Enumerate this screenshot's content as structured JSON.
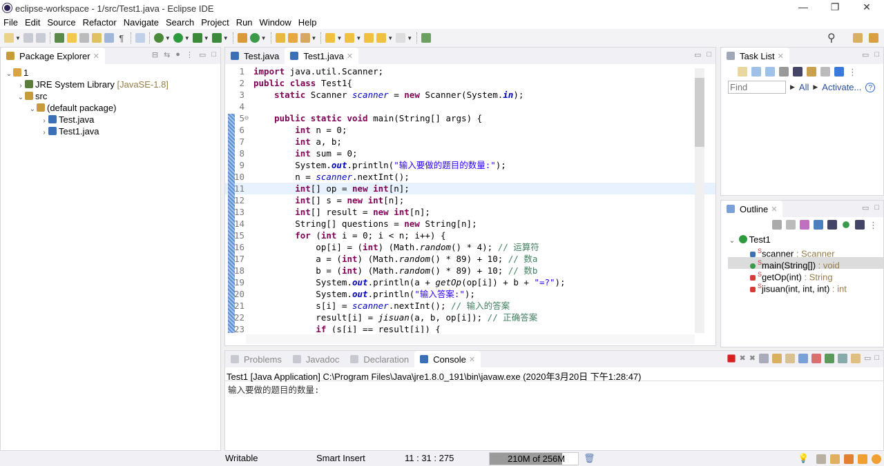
{
  "window": {
    "title": "eclipse-workspace - 1/src/Test1.java - Eclipse IDE",
    "min": "—",
    "restore": "❐",
    "close": "✕"
  },
  "menu": [
    "File",
    "Edit",
    "Source",
    "Refactor",
    "Navigate",
    "Search",
    "Project",
    "Run",
    "Window",
    "Help"
  ],
  "package_explorer": {
    "title": "Package Explorer",
    "tree": [
      {
        "label": "1",
        "decor": "",
        "depth": 0,
        "twisty": "⌄",
        "icon": "java-project-icon",
        "color": "#d9a441"
      },
      {
        "label": "JRE System Library",
        "decor": " [JavaSE-1.8]",
        "depth": 1,
        "twisty": "›",
        "icon": "library-icon",
        "color": "#5a7d3a"
      },
      {
        "label": "src",
        "decor": "",
        "depth": 1,
        "twisty": "⌄",
        "icon": "source-folder-icon",
        "color": "#c79a3c"
      },
      {
        "label": "(default package)",
        "decor": "",
        "depth": 2,
        "twisty": "⌄",
        "icon": "package-icon",
        "color": "#c79a3c"
      },
      {
        "label": "Test.java",
        "decor": "",
        "depth": 3,
        "twisty": "›",
        "icon": "java-file-icon",
        "color": "#3b6fb6"
      },
      {
        "label": "Test1.java",
        "decor": "",
        "depth": 3,
        "twisty": "›",
        "icon": "java-file-icon",
        "color": "#3b6fb6"
      }
    ]
  },
  "editor": {
    "tabs": [
      {
        "label": "Test.java",
        "active": false
      },
      {
        "label": "Test1.java",
        "active": true
      }
    ],
    "current_line": 11,
    "lines": [
      [
        [
          "k",
          "import"
        ],
        [
          "p",
          " java.util.Scanner;"
        ]
      ],
      [
        [
          "k",
          "public"
        ],
        [
          "p",
          " "
        ],
        [
          "k",
          "class"
        ],
        [
          "p",
          " Test1{"
        ]
      ],
      [
        [
          "p",
          "    "
        ],
        [
          "k",
          "static"
        ],
        [
          "p",
          " Scanner "
        ],
        [
          "f",
          "scanner"
        ],
        [
          "p",
          " = "
        ],
        [
          "k",
          "new"
        ],
        [
          "p",
          " Scanner(System."
        ],
        [
          "fb",
          "in"
        ],
        [
          "p",
          ");"
        ]
      ],
      [],
      [
        [
          "p",
          "    "
        ],
        [
          "k",
          "public"
        ],
        [
          "p",
          " "
        ],
        [
          "k",
          "static"
        ],
        [
          "p",
          " "
        ],
        [
          "k",
          "void"
        ],
        [
          "p",
          " main(String[] args) {"
        ]
      ],
      [
        [
          "p",
          "        "
        ],
        [
          "k",
          "int"
        ],
        [
          "p",
          " n = 0;"
        ]
      ],
      [
        [
          "p",
          "        "
        ],
        [
          "k",
          "int"
        ],
        [
          "p",
          " a, b;"
        ]
      ],
      [
        [
          "p",
          "        "
        ],
        [
          "k",
          "int"
        ],
        [
          "p",
          " sum = 0;"
        ]
      ],
      [
        [
          "p",
          "        System."
        ],
        [
          "fb",
          "out"
        ],
        [
          "p",
          ".println("
        ],
        [
          "s",
          "\"输入要做的题目的数量:\""
        ],
        [
          "p",
          ");"
        ]
      ],
      [
        [
          "p",
          "        n = "
        ],
        [
          "f",
          "scanner"
        ],
        [
          "p",
          ".nextInt();"
        ]
      ],
      [
        [
          "p",
          "        "
        ],
        [
          "k",
          "int"
        ],
        [
          "p",
          "[] op = "
        ],
        [
          "k",
          "new"
        ],
        [
          "p",
          " "
        ],
        [
          "k",
          "int"
        ],
        [
          "p",
          "[n];"
        ]
      ],
      [
        [
          "p",
          "        "
        ],
        [
          "k",
          "int"
        ],
        [
          "p",
          "[] s = "
        ],
        [
          "k",
          "new"
        ],
        [
          "p",
          " "
        ],
        [
          "k",
          "int"
        ],
        [
          "p",
          "[n];"
        ]
      ],
      [
        [
          "p",
          "        "
        ],
        [
          "k",
          "int"
        ],
        [
          "p",
          "[] result = "
        ],
        [
          "k",
          "new"
        ],
        [
          "p",
          " "
        ],
        [
          "k",
          "int"
        ],
        [
          "p",
          "[n];"
        ]
      ],
      [
        [
          "p",
          "        String[] questions = "
        ],
        [
          "k",
          "new"
        ],
        [
          "p",
          " String[n];"
        ]
      ],
      [
        [
          "p",
          "        "
        ],
        [
          "k",
          "for"
        ],
        [
          "p",
          " ("
        ],
        [
          "k",
          "int"
        ],
        [
          "p",
          " i = 0; i < n; i++) {"
        ]
      ],
      [
        [
          "p",
          "            op[i] = ("
        ],
        [
          "k",
          "int"
        ],
        [
          "p",
          ") (Math."
        ],
        [
          "m",
          "random"
        ],
        [
          "p",
          "() * 4); "
        ],
        [
          "c",
          "// 运算符"
        ]
      ],
      [
        [
          "p",
          "            a = ("
        ],
        [
          "k",
          "int"
        ],
        [
          "p",
          ") (Math."
        ],
        [
          "m",
          "random"
        ],
        [
          "p",
          "() * 89) + 10; "
        ],
        [
          "c",
          "// 数a"
        ]
      ],
      [
        [
          "p",
          "            b = ("
        ],
        [
          "k",
          "int"
        ],
        [
          "p",
          ") (Math."
        ],
        [
          "m",
          "random"
        ],
        [
          "p",
          "() * 89) + 10; "
        ],
        [
          "c",
          "// 数b"
        ]
      ],
      [
        [
          "p",
          "            System."
        ],
        [
          "fb",
          "out"
        ],
        [
          "p",
          ".println(a + "
        ],
        [
          "m",
          "getOp"
        ],
        [
          "p",
          "(op[i]) + b + "
        ],
        [
          "s",
          "\"=?\""
        ],
        [
          "p",
          ");"
        ]
      ],
      [
        [
          "p",
          "            System."
        ],
        [
          "fb",
          "out"
        ],
        [
          "p",
          ".println("
        ],
        [
          "s",
          "\"输入答案:\""
        ],
        [
          "p",
          ");"
        ]
      ],
      [
        [
          "p",
          "            s[i] = "
        ],
        [
          "f",
          "scanner"
        ],
        [
          "p",
          ".nextInt(); "
        ],
        [
          "c",
          "// 输入的答案"
        ]
      ],
      [
        [
          "p",
          "            result[i] = "
        ],
        [
          "m",
          "jisuan"
        ],
        [
          "p",
          "(a, b, op[i]); "
        ],
        [
          "c",
          "// 正确答案"
        ]
      ],
      [
        [
          "p",
          "            "
        ],
        [
          "k",
          "if"
        ],
        [
          "p",
          " (s[i] == result[i]) {"
        ]
      ]
    ]
  },
  "task_list": {
    "title": "Task List",
    "find_placeholder": "Find",
    "all": "All",
    "activate": "Activate...",
    "help": "?"
  },
  "outline": {
    "title": "Outline",
    "root": "Test1",
    "items": [
      {
        "name": "scanner",
        "type": " : Scanner",
        "icon": "field-default-icon",
        "color": "#3b6fb6",
        "selected": false
      },
      {
        "name": "main(String[])",
        "type": " : void",
        "icon": "method-public-icon",
        "color": "#3a9a4a",
        "selected": true
      },
      {
        "name": "getOp(int)",
        "type": " : String",
        "icon": "method-private-icon",
        "color": "#d83a3a",
        "selected": false
      },
      {
        "name": "jisuan(int, int, int)",
        "type": " : int",
        "icon": "method-private-icon",
        "color": "#d83a3a",
        "selected": false
      }
    ],
    "static_marker": "S"
  },
  "bottom": {
    "tabs": [
      {
        "label": "Problems",
        "active": false
      },
      {
        "label": "Javadoc",
        "active": false
      },
      {
        "label": "Declaration",
        "active": false
      },
      {
        "label": "Console",
        "active": true
      }
    ],
    "console_header": "Test1 [Java Application] C:\\Program Files\\Java\\jre1.8.0_191\\bin\\javaw.exe (2020年3月20日 下午1:28:47)",
    "console_output": "输入要做的题目的数量:"
  },
  "status": {
    "writable": "Writable",
    "insert_mode": "Smart Insert",
    "position": "11 : 31 : 275",
    "heap": "210M of 256M",
    "heap_fraction": 0.82
  }
}
